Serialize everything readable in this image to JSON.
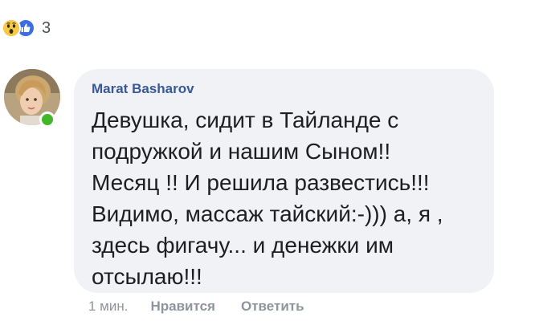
{
  "reactions": {
    "icons": [
      "wow-icon",
      "like-icon"
    ],
    "count": "3"
  },
  "comment": {
    "author": "Marat Basharov",
    "text": "Девушка, сидит в Тайланде с\nподружкой и нашим Сыном!!\nМесяц !! И решила развестись!!!\nВидимо, массаж тайский:-))) а, я ,\nздесь фигачу... и денежки им\nотсылаю!!!",
    "time": "1 мин.",
    "like_label": "Нравится",
    "reply_label": "Ответить"
  },
  "colors": {
    "bubble": "#f0f2f5",
    "author": "#385898",
    "online": "#42b72a",
    "like": "#3b6fe0",
    "wow": "#f7c948"
  }
}
